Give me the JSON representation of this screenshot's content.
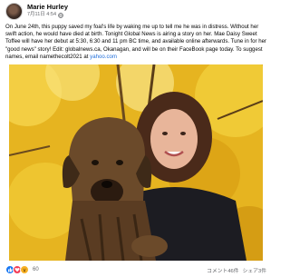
{
  "post": {
    "author": "Marie Hurley",
    "date": "7月11日 4:54",
    "privacy_icon": "globe-icon",
    "text_main": "On June 24th, this puppy saved my foal's life by waking me up to tell me he was in distress. Without her swift action, he would have died at birth. Tonight Global News is airing a story on her. Mae Daisy Sweet Toffee will have her debut at 5:30, 6:30 and 11 pm BC time, and available online afterwards. Tune in for her \"good news\" story! Edit: globalnews.ca, Okanagan, and will be on their FaceBook page today. To suggest names, email namethecolt2021 at ",
    "text_link": "yahoo.com"
  },
  "footer": {
    "reaction_icons": [
      "like-icon",
      "love-icon",
      "wow-icon"
    ],
    "reaction_count": "60",
    "comments": "コメント46件",
    "shares": "シェア3件"
  },
  "colors": {
    "link": "#216fdb",
    "like": "#1877f2",
    "love": "#f33e58",
    "wow": "#f7b125",
    "muted": "#65676b"
  }
}
